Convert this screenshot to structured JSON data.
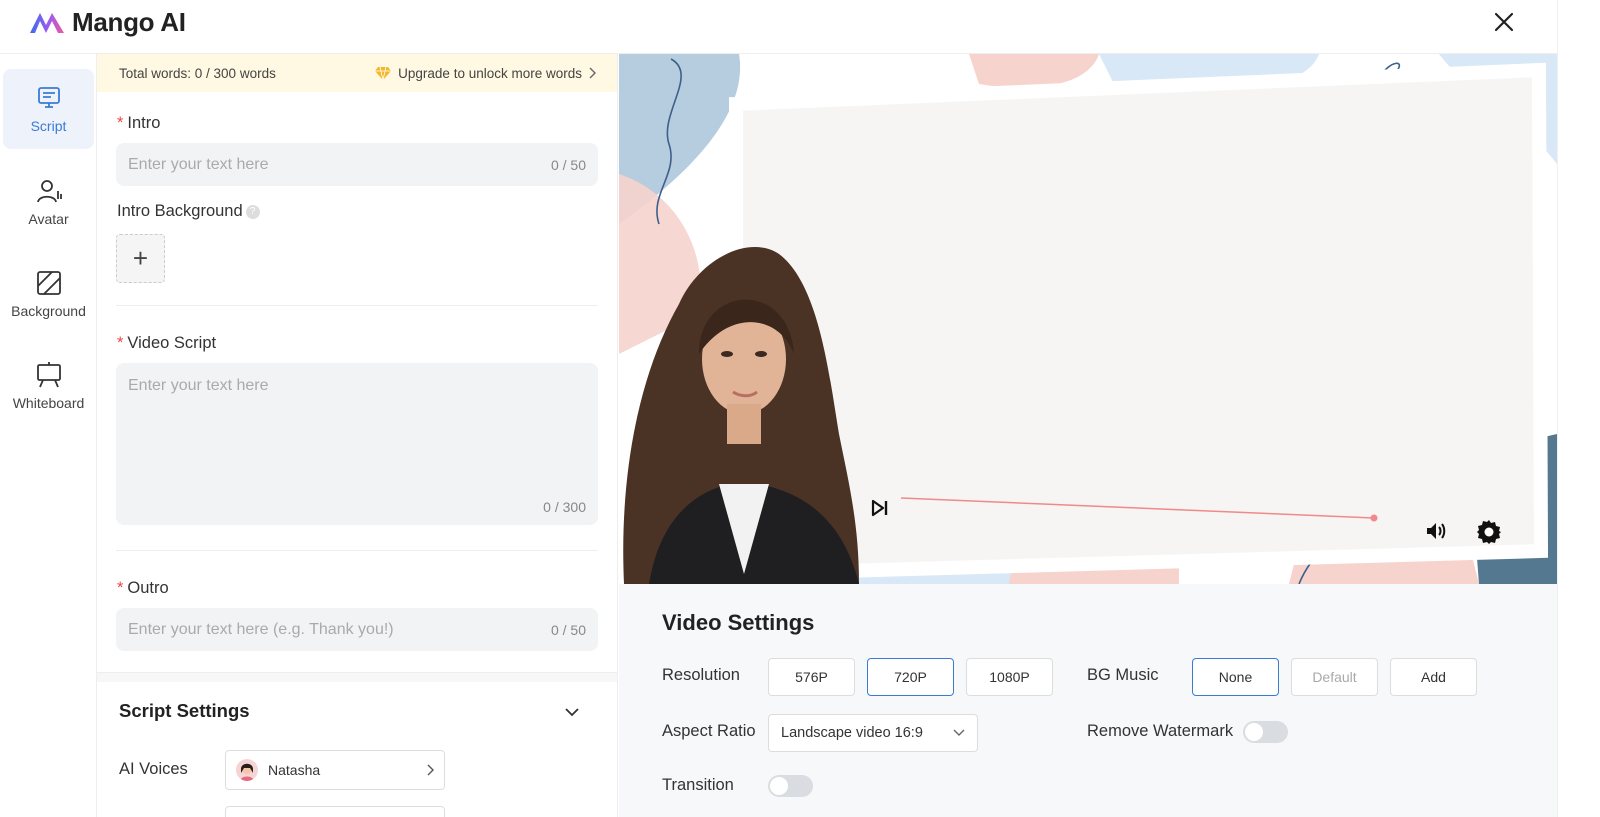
{
  "app": {
    "name": "Mango AI"
  },
  "wordbar": {
    "total": "Total words: 0 / 300 words",
    "upgrade": "Upgrade to unlock more words"
  },
  "sidenav": {
    "items": [
      {
        "label": "Script",
        "icon": "script-icon",
        "active": true
      },
      {
        "label": "Avatar",
        "icon": "avatar-icon",
        "active": false
      },
      {
        "label": "Background",
        "icon": "background-icon",
        "active": false
      },
      {
        "label": "Whiteboard",
        "icon": "whiteboard-icon",
        "active": false
      }
    ]
  },
  "script": {
    "intro": {
      "label": "Intro",
      "placeholder": "Enter your text here",
      "count": "0 / 50"
    },
    "intro_background": {
      "label": "Intro Background",
      "help": "?",
      "add": "+"
    },
    "video_script": {
      "label": "Video Script",
      "placeholder": "Enter your text here",
      "count": "0 / 300"
    },
    "outro": {
      "label": "Outro",
      "placeholder": "Enter your text here (e.g. Thank you!)",
      "count": "0 / 50"
    },
    "required_mark": "*"
  },
  "script_settings": {
    "title": "Script Settings",
    "ai_voices_label": "AI Voices",
    "voice": "Natasha"
  },
  "video_settings": {
    "title": "Video Settings",
    "resolution": {
      "label": "Resolution",
      "options": [
        "576P",
        "720P",
        "1080P"
      ],
      "selected": "720P"
    },
    "bg_music": {
      "label": "BG Music",
      "options": [
        "None",
        "Default",
        "Add"
      ],
      "selected": "None"
    },
    "aspect_ratio": {
      "label": "Aspect Ratio",
      "value": "Landscape video 16:9"
    },
    "remove_watermark": {
      "label": "Remove Watermark",
      "on": false
    },
    "transition": {
      "label": "Transition",
      "on": false
    }
  },
  "player": {
    "progress": 0.0
  },
  "colors": {
    "accent": "#3b7bd4",
    "required": "#e5484d",
    "progress": "#f08a8a",
    "upgrade_bg": "#fff8e2"
  }
}
